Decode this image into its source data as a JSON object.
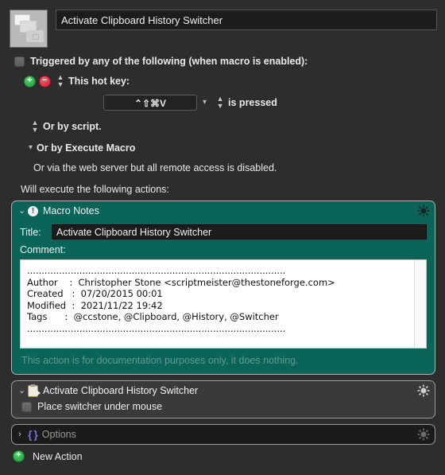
{
  "header": {
    "macro_icon": "clipboard-stack-icon",
    "macro_name": "Activate Clipboard History Switcher"
  },
  "trigger": {
    "enabled_checkbox_label": "Triggered by any of the following (when macro is enabled):",
    "add_button": "+",
    "remove_button": "−",
    "hot_key_label": "This hot key:",
    "hot_key_value": "⌃⇧⌘V",
    "hot_key_condition": "is pressed",
    "or_by_script": "Or by script.",
    "or_by_execute_macro": "Or by Execute Macro",
    "web_server_note": "Or via the web server but all remote access is disabled.",
    "will_execute": "Will execute the following actions:"
  },
  "actions": [
    {
      "name": "Macro Notes",
      "icon": "exclamation-circle-icon",
      "disclosure": "⌄",
      "gear": "gear-icon",
      "title_label": "Title:",
      "title_value": "Activate Clipboard History Switcher",
      "comment_label": "Comment:",
      "comment_text": ".........................................................................................\nAuthor    :  Christopher Stone <scriptmeister@thestoneforge.com>\nCreated   :  07/20/2015 00:01\nModified  :  2021/11/22 19:42\nTags      :  @ccstone, @Clipboard, @History, @Switcher\n.........................................................................................",
      "footer_note": "This action is for documentation purposes only, it does nothing."
    },
    {
      "name": "Activate Clipboard History Switcher",
      "icon": "clipboard-arrow-icon",
      "disclosure": "⌄",
      "gear": "gear-icon",
      "checkbox_label": "Place switcher under mouse"
    },
    {
      "name": "Options",
      "icon": "braces-icon",
      "disclosure": "›",
      "gear": "gear-icon"
    }
  ],
  "footer": {
    "new_action_label": "New Action",
    "new_action_icon": "plus-circle-icon"
  },
  "colors": {
    "window_bg": "#2d2d2d",
    "notes_teal": "#0a6458",
    "action_gray": "#3a3a3a",
    "options_dark": "#1b1b1b",
    "accent_green": "#1d9b37",
    "accent_red": "#cf1d2d",
    "braces_purple": "#6f6fe0"
  }
}
